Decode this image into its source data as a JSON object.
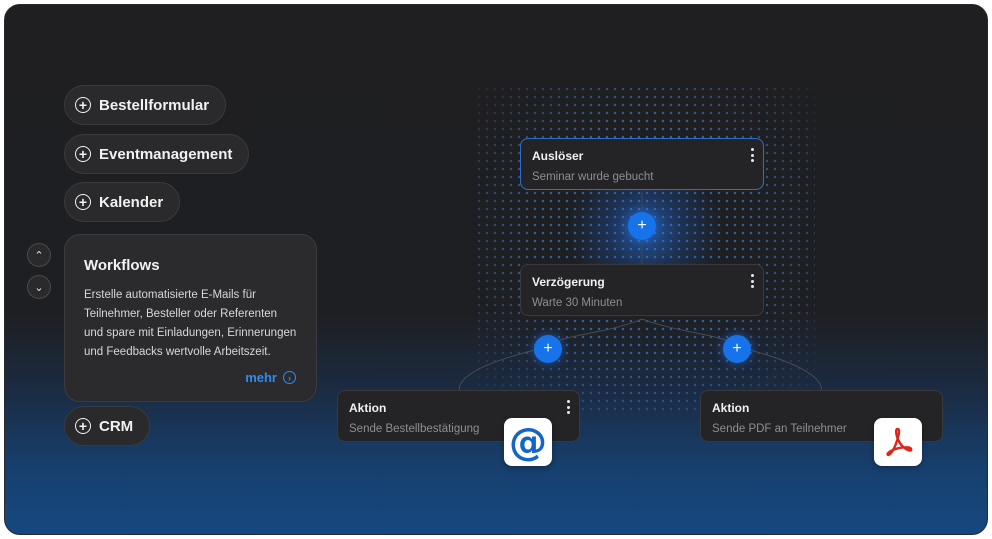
{
  "features": [
    {
      "label": "Bestellformular"
    },
    {
      "label": "Eventmanagement"
    },
    {
      "label": "Kalender"
    },
    {
      "label": "CRM"
    }
  ],
  "nav": {
    "up_icon": "chevron-up-icon",
    "down_icon": "chevron-down-icon"
  },
  "workflows_card": {
    "title": "Workflows",
    "description": "Erstelle automatisierte E-Mails für Teilnehmer, Besteller oder Referenten und spare mit Einladungen, Erinnerungen und Feedbacks wertvolle Arbeitszeit.",
    "more_label": "mehr"
  },
  "workflow": {
    "trigger": {
      "title": "Auslöser",
      "subtitle": "Seminar wurde gebucht"
    },
    "delay": {
      "title": "Verzögerung",
      "subtitle": "Warte 30 Minuten"
    },
    "action_left": {
      "title": "Aktion",
      "subtitle": "Sende Bestellbestätigung"
    },
    "action_right": {
      "title": "Aktion",
      "subtitle": "Sende PDF an Teilnehmer"
    },
    "add_symbol": "+"
  },
  "icons": {
    "email": "at-sign-icon",
    "pdf": "acrobat-pdf-icon"
  },
  "colors": {
    "accent": "#1673ea",
    "link": "#2f8bf0",
    "pdf_red": "#e02418"
  }
}
